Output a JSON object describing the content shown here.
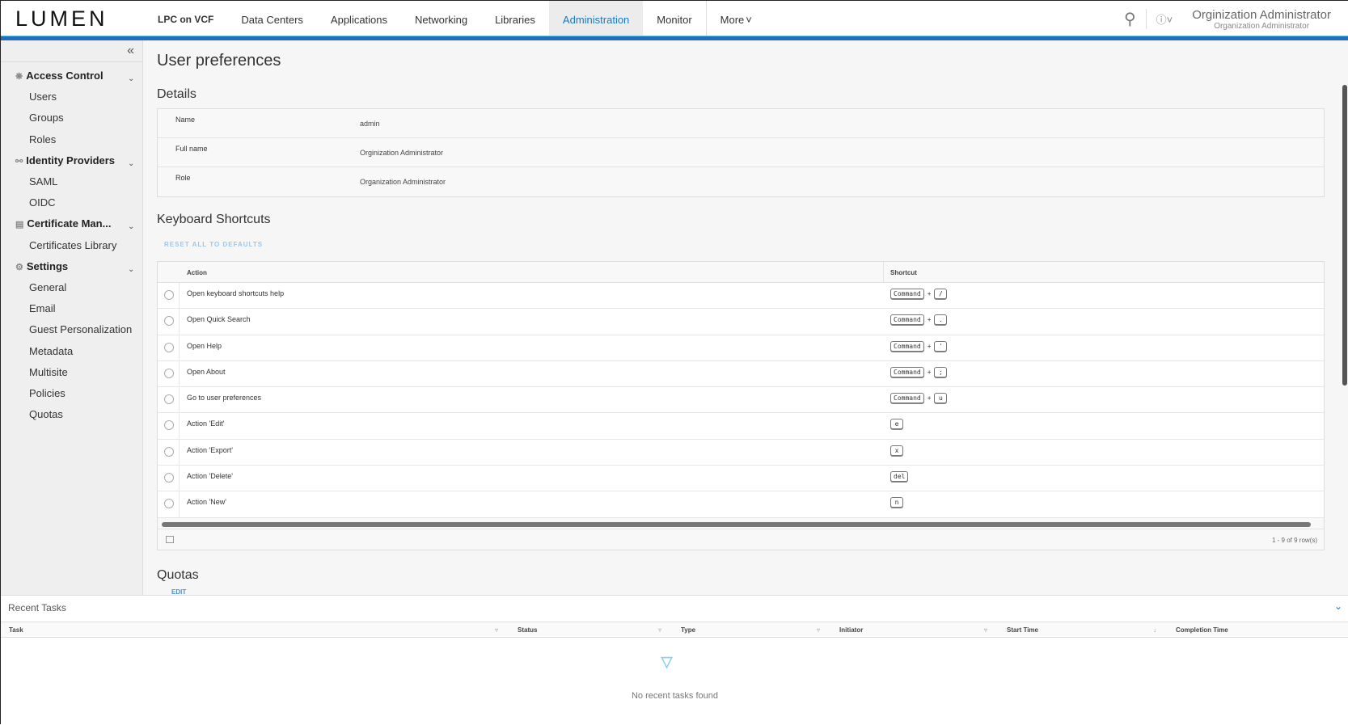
{
  "header": {
    "logo": "LUMEN",
    "nav": [
      "LPC on VCF",
      "Data Centers",
      "Applications",
      "Networking",
      "Libraries",
      "Administration",
      "Monitor",
      "More"
    ],
    "active": "Administration",
    "user_name": "Orginization Administrator",
    "user_role": "Organization Administrator"
  },
  "sidebar": {
    "groups": [
      {
        "label": "Access Control",
        "items": [
          "Users",
          "Groups",
          "Roles"
        ]
      },
      {
        "label": "Identity Providers",
        "items": [
          "SAML",
          "OIDC"
        ]
      },
      {
        "label": "Certificate Man...",
        "items": [
          "Certificates Library"
        ]
      },
      {
        "label": "Settings",
        "items": [
          "General",
          "Email",
          "Guest Personalization",
          "Metadata",
          "Multisite",
          "Policies",
          "Quotas"
        ]
      }
    ]
  },
  "main": {
    "title": "User preferences",
    "details_heading": "Details",
    "details": [
      {
        "k": "Name",
        "v": "admin"
      },
      {
        "k": "Full name",
        "v": "Orginization Administrator"
      },
      {
        "k": "Role",
        "v": "Organization Administrator"
      }
    ],
    "shortcuts_heading": "Keyboard Shortcuts",
    "reset_label": "RESET ALL TO DEFAULTS",
    "col_action": "Action",
    "col_shortcut": "Shortcut",
    "shortcuts": [
      {
        "action": "Open keyboard shortcuts help",
        "mod": "Command",
        "key": "/"
      },
      {
        "action": "Open Quick Search",
        "mod": "Command",
        "key": "."
      },
      {
        "action": "Open Help",
        "mod": "Command",
        "key": "'"
      },
      {
        "action": "Open About",
        "mod": "Command",
        "key": ";"
      },
      {
        "action": "Go to user preferences",
        "mod": "Command",
        "key": "u"
      },
      {
        "action": "Action 'Edit'",
        "key": "e"
      },
      {
        "action": "Action 'Export'",
        "key": "x"
      },
      {
        "action": "Action 'Delete'",
        "key": "del"
      },
      {
        "action": "Action 'New'",
        "key": "n"
      }
    ],
    "row_count": "1 - 9 of 9 row(s)",
    "quotas_heading": "Quotas",
    "edit_label": "EDIT"
  },
  "tasks": {
    "title": "Recent Tasks",
    "columns": [
      "Task",
      "Status",
      "Type",
      "Initiator",
      "Start Time",
      "Completion Time"
    ],
    "empty": "No recent tasks found"
  }
}
